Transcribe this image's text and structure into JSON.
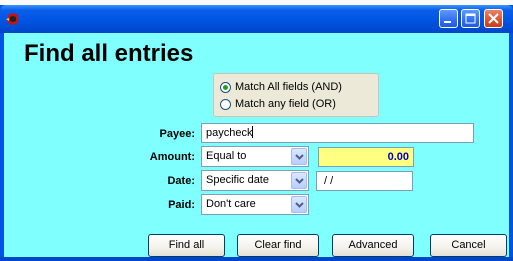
{
  "window": {
    "heading": "Find all entries",
    "controls": [
      "minimize-icon",
      "maximize-icon",
      "close-icon"
    ]
  },
  "match": {
    "options": [
      {
        "label": "Match All fields (AND)",
        "checked": true
      },
      {
        "label": "Match any field (OR)",
        "checked": false
      }
    ]
  },
  "form": {
    "payee": {
      "label": "Payee:",
      "value": "paycheck"
    },
    "amount": {
      "label": "Amount:",
      "selected": "Equal to",
      "value": "0.00"
    },
    "date": {
      "label": "Date:",
      "selected": "Specific date",
      "value": " / /"
    },
    "paid": {
      "label": "Paid:",
      "selected": "Don't care"
    }
  },
  "buttons": {
    "find_all": "Find all",
    "clear_find": "Clear find",
    "advanced": "Advanced",
    "cancel": "Cancel"
  },
  "colors": {
    "client_bg": "#80ffff",
    "titlebar": "#0054e3",
    "amount_bg": "#ffff80",
    "amount_text": "#0000c0"
  }
}
